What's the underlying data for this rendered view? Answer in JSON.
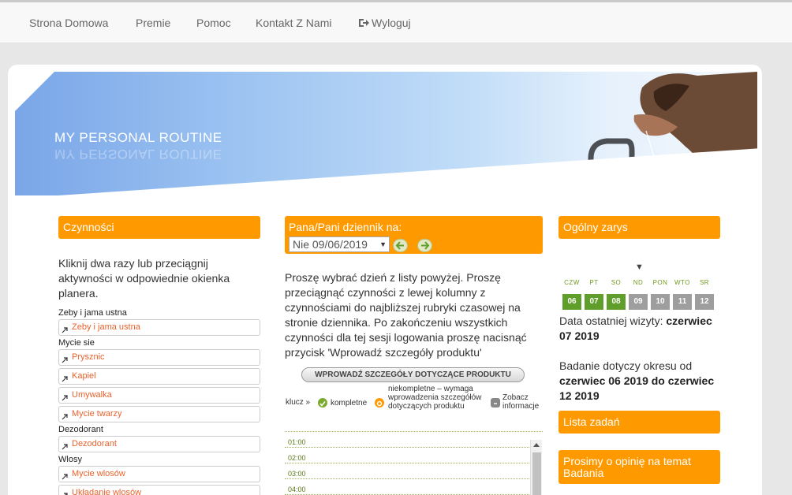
{
  "nav": {
    "items": [
      "Strona Domowa",
      "Premie",
      "Pomoc",
      "Kontakt Z Nami"
    ],
    "logout": "Wyloguj"
  },
  "banner": {
    "title": "MY PERSONAL ROUTINE"
  },
  "left": {
    "header": "Czynności",
    "intro": "Kliknij dwa razy lub przeciągnij aktywności w odpowiednie okienka planera.",
    "groups": [
      {
        "label": "Zeby i jama ustna",
        "items": [
          "Zeby i jama ustna"
        ]
      },
      {
        "label": "Mycie sie",
        "items": [
          "Prysznic",
          "Kapiel",
          "Umywalka",
          "Mycie twarzy"
        ]
      },
      {
        "label": "Dezodorant",
        "items": [
          "Dezodorant"
        ]
      },
      {
        "label": "Wlosy",
        "items": [
          "Mycie wlosów",
          "Układanie wlosów"
        ]
      }
    ]
  },
  "middle": {
    "header": "Pana/Pani dziennik na:",
    "date_value": "Nie 09/06/2019",
    "instructions": "Proszę wybrać dzień z listy powyżej. Proszę przeciągnąć czynności z lewej kolumny z czynnościami do najbliższej rubryki czasowej na stronie dziennika. Po zakończeniu wszystkich czynności dla tej sesji logowania proszę nacisnąć przycisk 'Wprowadź szczegóły produktu'",
    "product_button": "WPROWADŹ SZCZEGÓŁY DOTYCZĄCE PRODUKTU",
    "key": {
      "label": "klucz »",
      "complete": "kompletne",
      "incomplete": "niekompletne – wymaga wprowadzenia szczegółów dotyczących produktu",
      "info": "Zobacz informacje"
    },
    "times": [
      "01:00",
      "02:00",
      "03:00",
      "04:00"
    ]
  },
  "right": {
    "header": "Ogólny zarys",
    "days": [
      {
        "label": "CZW",
        "num": "06",
        "color": "#5f9e2a"
      },
      {
        "label": "PT",
        "num": "07",
        "color": "#5f9e2a"
      },
      {
        "label": "SO",
        "num": "08",
        "color": "#5f9e2a"
      },
      {
        "label": "ND",
        "num": "09",
        "color": "#9e9e9e"
      },
      {
        "label": "PON",
        "num": "10",
        "color": "#9e9e9e"
      },
      {
        "label": "WTO",
        "num": "11",
        "color": "#9e9e9e"
      },
      {
        "label": "SR",
        "num": "12",
        "color": "#9e9e9e"
      }
    ],
    "last_visit_label": "Data ostatniej wizyty:",
    "last_visit_value": "czerwiec 07 2019",
    "period_label": "Badanie dotyczy okresu od",
    "period_value": "czerwiec 06 2019 do czerwiec 12 2019",
    "tasks_header": "Lista zadań",
    "opinion_header": "Prosimy o opinię na temat Badania"
  },
  "colors": {
    "accent": "#ff9900",
    "link": "#e9622c",
    "done": "#5f9e2a",
    "pending": "#9e9e9e"
  }
}
